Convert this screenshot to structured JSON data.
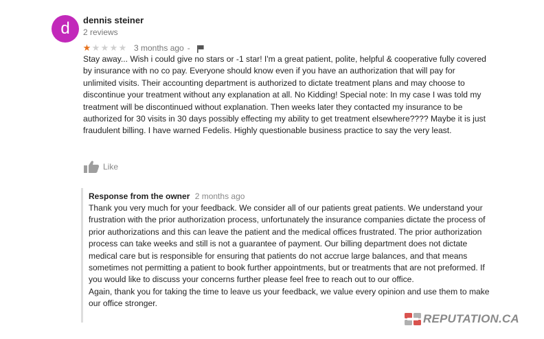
{
  "reviewer": {
    "initial": "d",
    "avatar_color": "#c229ba",
    "name": "dennis steiner",
    "reviews_count": "2 reviews"
  },
  "rating": {
    "stars": 1,
    "max_stars": 5,
    "star_color": "#e7711b",
    "date": "3 months ago",
    "separator": "-",
    "flag_icon": "flag-icon"
  },
  "review": {
    "text": "Stay away... Wish i could give no stars or -1 star! I'm a great patient, polite, helpful & cooperative fully covered by insurance with no co pay. Everyone should know even if you have an authorization that will pay for unlimited visits. Their accounting department is authorized to dictate treatment plans and may choose to discontinue your treatment without any explanation at all. No Kidding! Special note: In my case I was told my treatment will be discontinued without explanation. Then weeks later they contacted my insurance to be authorized for 30 visits in 30 days possibly effecting my ability to get treatment elsewhere???? Maybe it is just fraudulent billing. I have warned Fedelis. Highly questionable business practice to say the very least."
  },
  "like": {
    "label": "Like",
    "icon": "thumbs-up-icon"
  },
  "owner_response": {
    "title": "Response from the owner",
    "date": "2 months ago",
    "paragraph_1": "Thank you very much for your feedback. We consider all of our patients great patients. We understand your frustration with the prior authorization process, unfortunately the insurance companies dictate the process of prior authorizations and this can leave the patient and the medical offices frustrated. The prior authorization process can take weeks and still is not a guarantee of payment. Our billing department does not dictate medical care but is responsible for ensuring that patients do not accrue large balances, and that means sometimes not permitting a patient to book further appointments, but or treatments that are not preformed. If you would like to discuss your concerns further please feel free to reach out to our office.",
    "paragraph_2": "Again, thank you for taking the time to leave us your feedback, we value every opinion and use them to make our office stronger."
  },
  "watermark": {
    "text": "REPUTATION.CA",
    "logo_color": "#d9534f"
  }
}
